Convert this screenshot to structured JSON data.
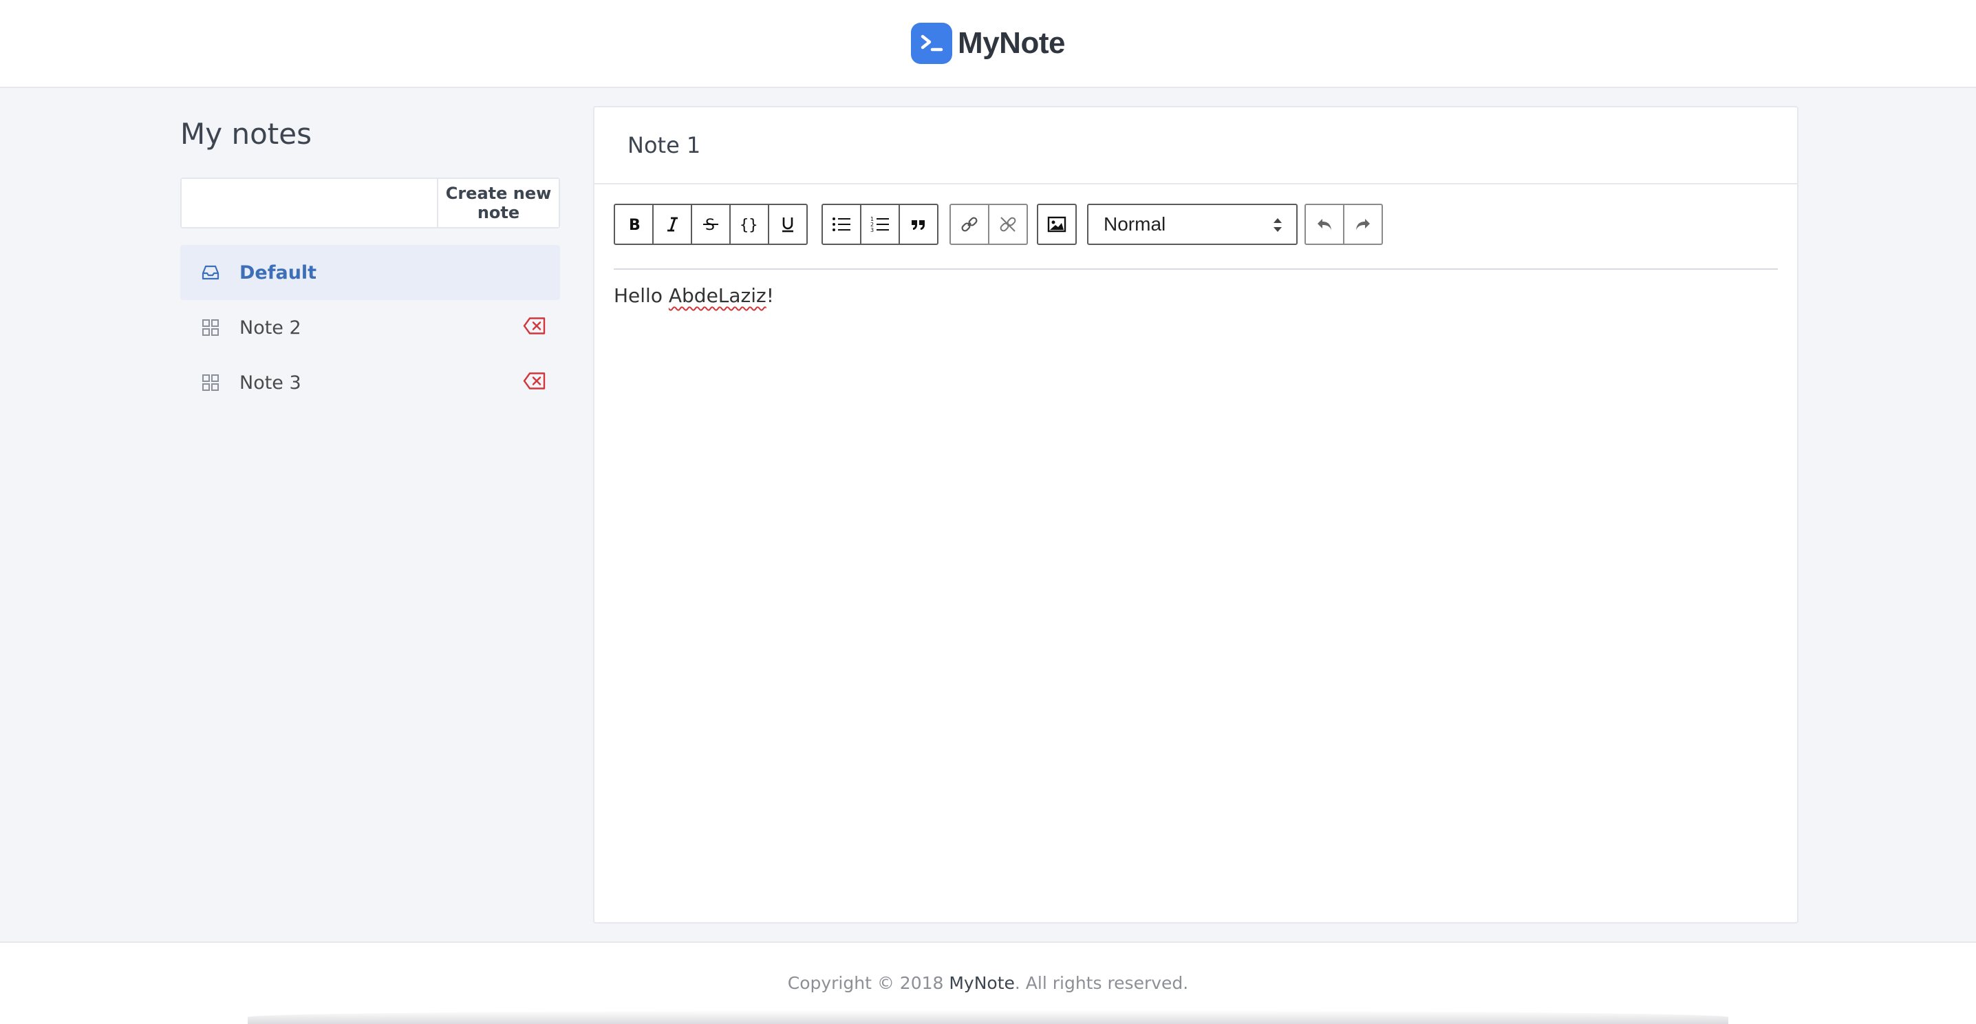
{
  "app": {
    "name": "MyNote",
    "accent": "#3d7ee8"
  },
  "sidebar": {
    "title": "My notes",
    "new_note": {
      "placeholder": "",
      "value": "",
      "button_label": "Create new note"
    },
    "items": [
      {
        "label": "Default",
        "icon": "inbox-icon",
        "active": true,
        "deletable": false
      },
      {
        "label": "Note 2",
        "icon": "grid-icon",
        "active": false,
        "deletable": true
      },
      {
        "label": "Note 3",
        "icon": "grid-icon",
        "active": false,
        "deletable": true
      }
    ],
    "delete_color": "#d0363a"
  },
  "editor": {
    "title": "Note 1",
    "format_select": {
      "selected": "Normal"
    },
    "toolbar_buttons": [
      "bold",
      "italic",
      "strikethrough",
      "code",
      "underline",
      "bulleted-list",
      "numbered-list",
      "blockquote",
      "link",
      "unlink",
      "image",
      "undo",
      "redo"
    ],
    "content": {
      "text_before": "Hello ",
      "misspelled": "AbdeLaziz",
      "text_after": "!"
    }
  },
  "footer": {
    "prefix": "Copyright © 2018 ",
    "brand": "MyNote",
    "suffix": ". All rights reserved."
  }
}
